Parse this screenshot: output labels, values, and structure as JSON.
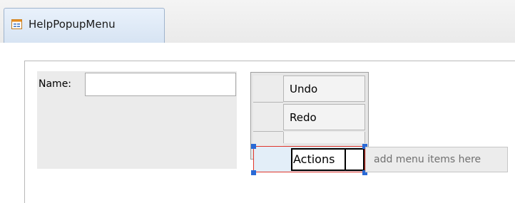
{
  "tab": {
    "title": "HelpPopupMenu",
    "icon": "form-icon"
  },
  "form": {
    "name_label": "Name:",
    "name_value": ""
  },
  "menu": {
    "items": [
      {
        "label": "Undo"
      },
      {
        "label": "Redo"
      }
    ],
    "editing_item": "Actions",
    "add_placeholder": "add menu items here"
  },
  "colors": {
    "selection_border": "#e0352b",
    "handle": "#2a6ad6",
    "tab_border": "#9fb4cd"
  }
}
